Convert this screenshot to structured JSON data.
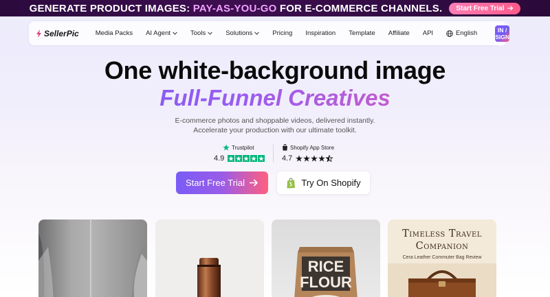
{
  "banner": {
    "text_lead": "GENERATE PRODUCT IMAGES:",
    "text_highlight": "PAY-AS-YOU-GO",
    "text_tail": "FOR E-COMMERCE CHANNELS.",
    "cta_label": "Start Free Trial"
  },
  "nav": {
    "logo": "SellerPic",
    "items": [
      {
        "label": "Media Packs",
        "dropdown": false
      },
      {
        "label": "AI Agent",
        "dropdown": true
      },
      {
        "label": "Tools",
        "dropdown": true
      },
      {
        "label": "Solutions",
        "dropdown": true
      },
      {
        "label": "Pricing",
        "dropdown": false
      },
      {
        "label": "Inspiration",
        "dropdown": false
      },
      {
        "label": "Template",
        "dropdown": false
      },
      {
        "label": "Affiliate",
        "dropdown": false
      },
      {
        "label": "API",
        "dropdown": false
      }
    ],
    "language": "English",
    "login_line1": "LOG IN /",
    "login_line2": "SIGN UP"
  },
  "hero": {
    "title": "One white-background image",
    "subtitle": "Full-Funnel Creatives",
    "desc_line1": "E-commerce photos and shoppable videos, delivered instantly.",
    "desc_line2": "Accelerate your production with our ultimate toolkit."
  },
  "ratings": {
    "trustpilot": {
      "brand": "Trustpilot",
      "score": "4.9",
      "stars": 5
    },
    "shopify": {
      "brand": "Shopify App Store",
      "score": "4.7",
      "stars": 4.7
    }
  },
  "cta": {
    "primary": "Start Free Trial",
    "secondary": "Try On Shopify"
  },
  "cards": [
    {
      "name": "hair-model-before-after"
    },
    {
      "name": "copper-bottle"
    },
    {
      "name": "rice-flour-bag",
      "text_line1": "RICE",
      "text_line2": "FLOUR"
    },
    {
      "name": "travel-companion",
      "title_line1": "Timeless Travel",
      "title_line2": "Companion",
      "caption": "Cera Leather Commuter Bag Review"
    }
  ],
  "colors": {
    "accent_purple": "#7a5cf6",
    "accent_pink": "#ff5f7f",
    "trustpilot_green": "#00b67a"
  }
}
